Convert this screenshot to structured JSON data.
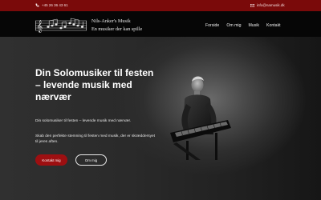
{
  "topbar": {
    "phone": "+45 26 36 43 61",
    "email": "info@namusik.dk",
    "phone_icon": "phone-icon",
    "email_icon": "mail-icon"
  },
  "brand": {
    "name": "Nils-Anker's Musik",
    "tagline": "En musiker der kan spille",
    "logo": "music-staff-logo"
  },
  "nav": {
    "items": [
      {
        "label": "Forside"
      },
      {
        "label": "Om mig"
      },
      {
        "label": "Musik"
      },
      {
        "label": "Kontakt"
      }
    ]
  },
  "hero": {
    "headline": [
      "Din Solomusiker til festen",
      "– levende musik med",
      "nærvær"
    ],
    "intro": "Din solomusiker til festen – levende musik med nærvær.",
    "body": "Skab den perfekte stemning til festen med musik, der er skræddersyet til jeres aften.",
    "primary_button": "Kontakt mig",
    "secondary_button": "Om mig"
  },
  "colors": {
    "accent": "#9d0f11",
    "topbar": "#7a0a0a",
    "navbar": "#060606"
  }
}
